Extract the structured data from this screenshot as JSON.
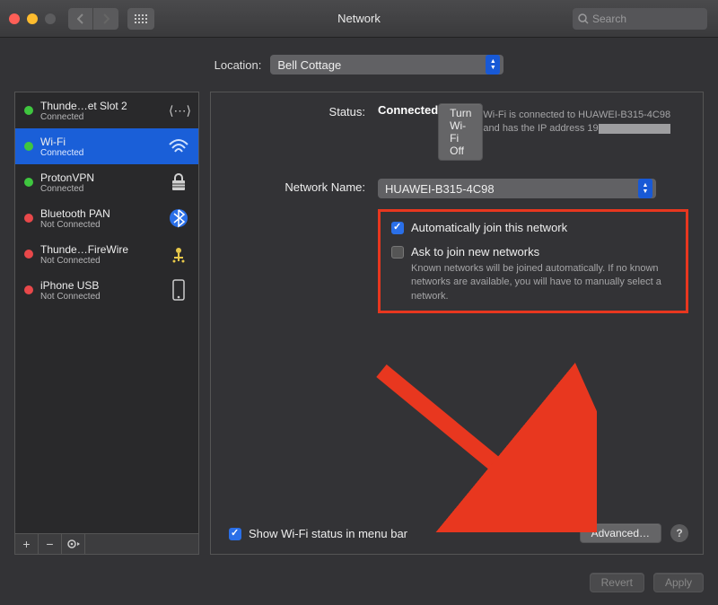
{
  "window": {
    "title": "Network"
  },
  "search": {
    "placeholder": "Search"
  },
  "location": {
    "label": "Location:",
    "value": "Bell Cottage"
  },
  "sidebar": {
    "items": [
      {
        "name": "Thunde…et Slot 2",
        "sub": "Connected",
        "status": "green",
        "icon": "thunderbolt"
      },
      {
        "name": "Wi-Fi",
        "sub": "Connected",
        "status": "green",
        "icon": "wifi"
      },
      {
        "name": "ProtonVPN",
        "sub": "Connected",
        "status": "green",
        "icon": "lock"
      },
      {
        "name": "Bluetooth PAN",
        "sub": "Not Connected",
        "status": "red",
        "icon": "bluetooth"
      },
      {
        "name": "Thunde…FireWire",
        "sub": "Not Connected",
        "status": "red",
        "icon": "firewire"
      },
      {
        "name": "iPhone USB",
        "sub": "Not Connected",
        "status": "red",
        "icon": "phone"
      }
    ]
  },
  "status": {
    "label": "Status:",
    "value": "Connected",
    "button": "Turn Wi-Fi Off",
    "desc_prefix": "Wi-Fi is connected to HUAWEI-B315-4C98 and has the IP address 19"
  },
  "network": {
    "label": "Network Name:",
    "value": "HUAWEI-B315-4C98"
  },
  "options": {
    "auto_join": "Automatically join this network",
    "ask_join": "Ask to join new networks",
    "ask_desc": "Known networks will be joined automatically. If no known networks are available, you will have to manually select a network."
  },
  "menubar": {
    "label": "Show Wi-Fi status in menu bar"
  },
  "advanced": "Advanced…",
  "footer": {
    "revert": "Revert",
    "apply": "Apply"
  }
}
